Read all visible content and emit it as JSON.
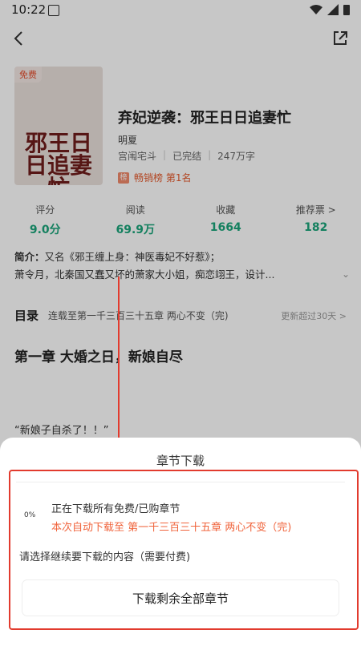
{
  "status_bar": {
    "time": "10:22",
    "icons": [
      "app-icon",
      "wifi-icon",
      "signal-icon",
      "battery-icon"
    ]
  },
  "header": {
    "back_icon": "chevron-left-icon",
    "share_icon": "share-icon"
  },
  "book": {
    "badge": "免费",
    "cover_title": "邪王日日追妻忙",
    "title": "弃妃逆袭：邪王日日追妻忙",
    "author": "明夏",
    "category": "宫闱宅斗",
    "status": "已完结",
    "words": "247万字",
    "rank_icon": "榜",
    "rank_text": "畅销榜 第1名"
  },
  "stats": [
    {
      "label": "评分",
      "value": "9.0分"
    },
    {
      "label": "阅读",
      "value": "69.9万"
    },
    {
      "label": "收藏",
      "value": "1664"
    },
    {
      "label": "推荐票 >",
      "value": "182"
    }
  ],
  "intro": {
    "label": "简介：",
    "line1": "又名《邪王缠上身：神医毒妃不好惹》；",
    "line2": "萧令月，北秦国又蠢又坏的萧家大小姐，痴恋翊王，设计..."
  },
  "toc": {
    "title": "目录",
    "latest": "连载至第一千三百三十五章 两心不变（完)",
    "update": "更新超过30天 >"
  },
  "chapter": {
    "title": "第一章 大婚之日，新娘自尽",
    "first_line": "“新娘子自杀了！！”"
  },
  "sheet": {
    "title": "章节下载",
    "progress": "0%",
    "downloading": "正在下载所有免费/已购章节",
    "auto_download": "本次自动下载至 第一千三百三十五章 两心不变（完)",
    "choose": "请选择继续要下载的内容（需要付费)",
    "download_rest_button": "下载剩余全部章节"
  },
  "colors": {
    "accent_green": "#1aa57a",
    "accent_orange": "#f0643c",
    "annotation_red": "#e23b2e"
  }
}
